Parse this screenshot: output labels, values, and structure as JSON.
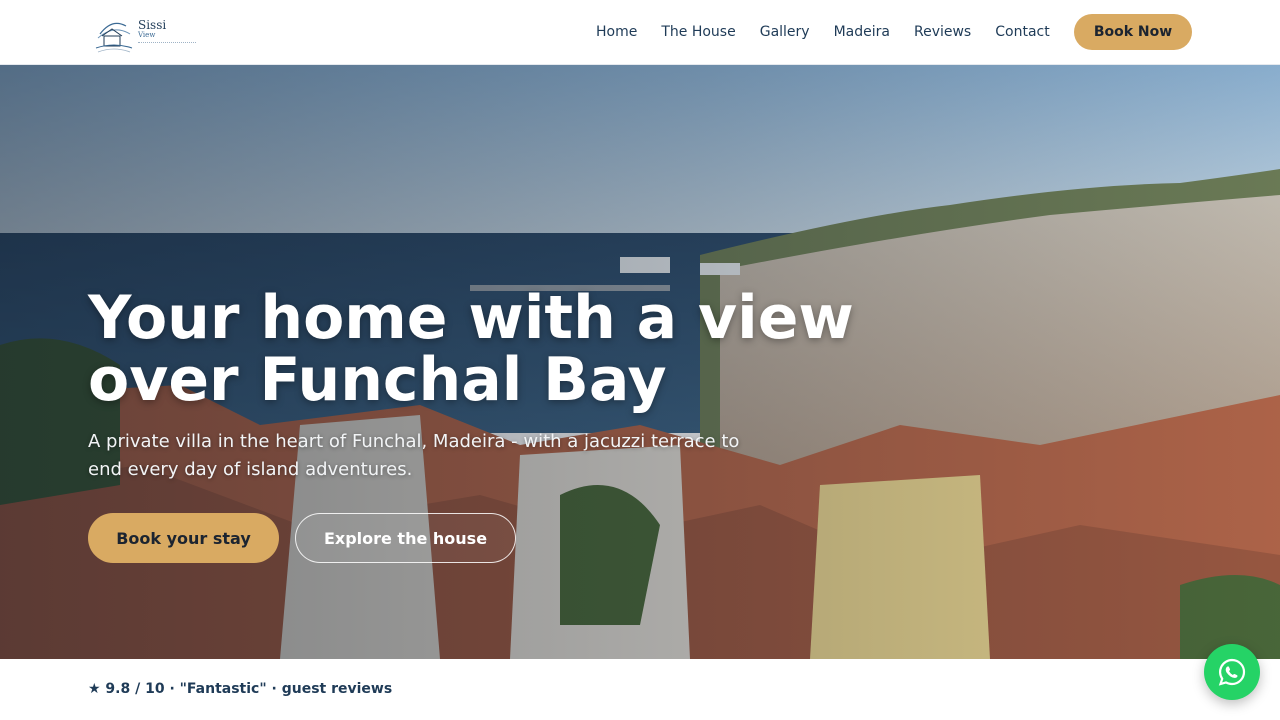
{
  "brand": {
    "name": "Sissi",
    "sub": "View"
  },
  "nav": {
    "items": [
      "Home",
      "The House",
      "Gallery",
      "Madeira",
      "Reviews",
      "Contact"
    ],
    "book_now": "Book Now"
  },
  "hero": {
    "title_line1": "Your home with a view",
    "title_line2": "over Funchal Bay",
    "subtitle": "A private villa in the heart of Funchal, Madeira - with a jacuzzi terrace to end every day of island adventures.",
    "primary_cta": "Book your stay",
    "secondary_cta": "Explore the house"
  },
  "rating": {
    "text": "★ 9.8 / 10 · \"Fantastic\" · guest reviews"
  },
  "icons": {
    "whatsapp": "whatsapp-icon",
    "logo": "house-logo-icon"
  },
  "colors": {
    "accent": "#d9aa62",
    "navy": "#1f3b57",
    "whatsapp": "#25d366"
  }
}
